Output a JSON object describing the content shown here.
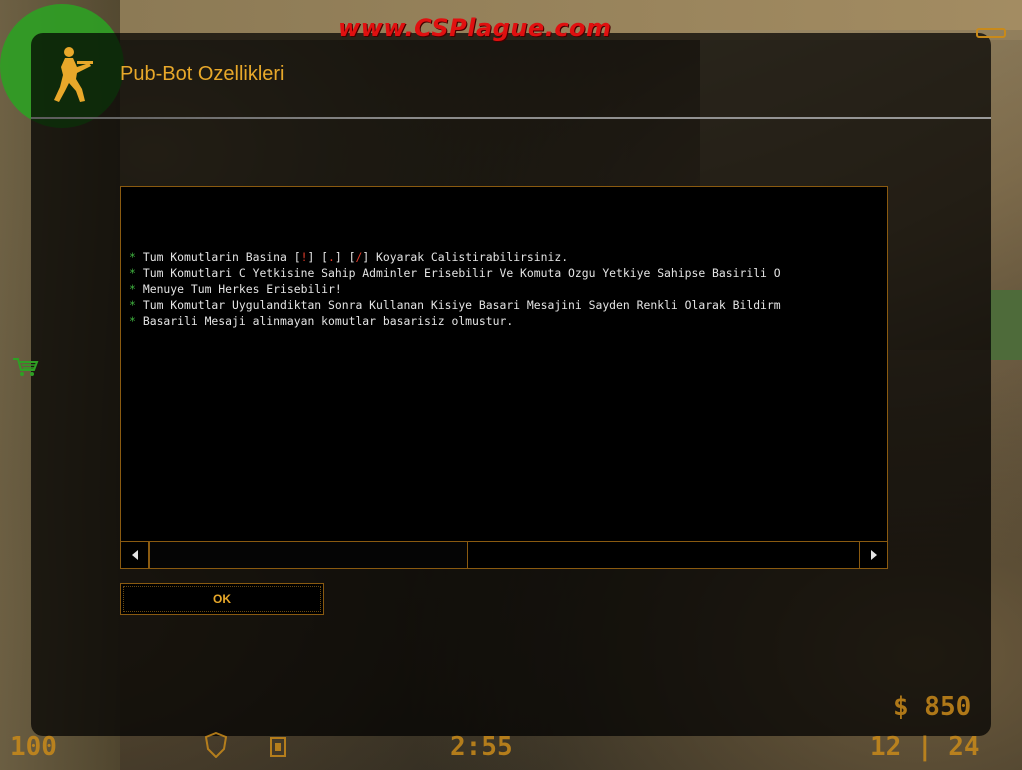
{
  "banner": {
    "text": "www.CSPlague.com"
  },
  "dialog": {
    "title": "Pub-Bot Ozellikleri",
    "lines": [
      {
        "parts": [
          "Tum Komutlarin Basina [",
          "!",
          "] [",
          ".",
          "] [",
          "/",
          "] Koyarak Calistirabilirsiniz."
        ]
      },
      {
        "text": "Tum Komutlari C Yetkisine Sahip Adminler Erisebilir Ve Komuta Ozgu Yetkiye Sahipse Basirili O"
      },
      {
        "text": "Menuye Tum Herkes Erisebilir!"
      },
      {
        "text": "Tum Komutlar Uygulandiktan Sonra Kullanan Kisiye Basari Mesajini Sayden Renkli Olarak Bildirm"
      },
      {
        "text": "Basarili Mesaji alinmayan komutlar basarisiz olmustur."
      }
    ],
    "bullet": "*",
    "ok_label": "OK"
  },
  "hud": {
    "health": "100",
    "armor_icon": "shield-icon",
    "bomb_icon": "bomb-icon",
    "timer": "2:55",
    "ammo": "12 | 24",
    "money": "$ 850"
  },
  "icons": {
    "logo": "counter-terrorist-logo-icon",
    "cart": "shopping-cart-icon",
    "scroll_left": "triangle-left-icon",
    "scroll_right": "triangle-right-icon"
  },
  "colors": {
    "title": "#e8a82a",
    "border": "#8a5a10",
    "banner": "#e01010",
    "bullet": "#3fb33f",
    "highlight_symbol": "#e33c2a"
  }
}
